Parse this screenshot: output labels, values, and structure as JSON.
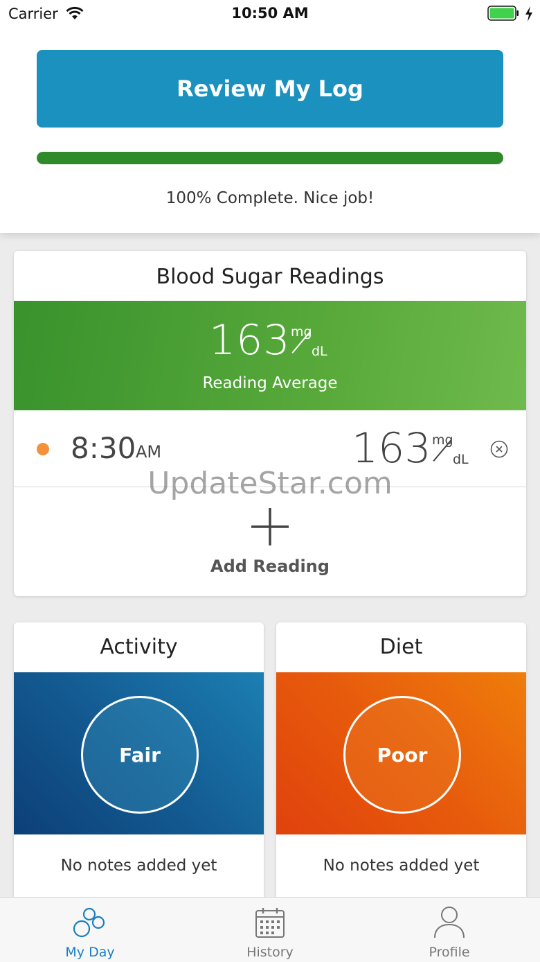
{
  "status_bar": {
    "carrier": "Carrier",
    "time": "10:50 AM"
  },
  "header": {
    "review_button_label": "Review My Log",
    "progress_percent": 100,
    "progress_text": "100% Complete. Nice job!"
  },
  "blood_sugar": {
    "title": "Blood Sugar Readings",
    "average_value": "163",
    "unit_top": "mg",
    "unit_bottom": "dL",
    "average_label": "Reading Average",
    "readings": [
      {
        "time": "8:30",
        "ampm": "AM",
        "value": "163",
        "unit_top": "mg",
        "unit_bottom": "dL",
        "dot_color": "#f4913a"
      }
    ],
    "add_label": "Add Reading"
  },
  "watermark": "UpdateStar.com",
  "activity": {
    "title": "Activity",
    "rating": "Fair",
    "notes": "No notes added yet"
  },
  "diet": {
    "title": "Diet",
    "rating": "Poor",
    "notes": "No notes added yet"
  },
  "tabs": [
    {
      "label": "My Day",
      "icon": "my-day-icon",
      "active": true
    },
    {
      "label": "History",
      "icon": "calendar-icon",
      "active": false
    },
    {
      "label": "Profile",
      "icon": "person-icon",
      "active": false
    }
  ],
  "colors": {
    "primary_button": "#1a91be",
    "progress": "#2f8a2a",
    "active_tab": "#1a7fc0",
    "reading_dot": "#f4913a"
  }
}
